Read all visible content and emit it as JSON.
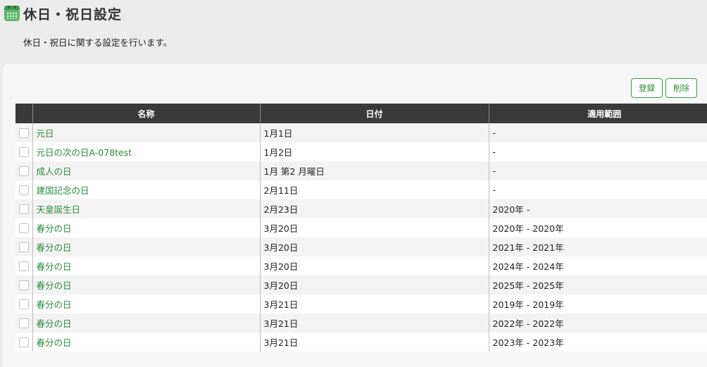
{
  "header": {
    "title": "休日・祝日設定",
    "description": "休日・祝日に関する設定を行います。"
  },
  "toolbar": {
    "register_label": "登録",
    "delete_label": "削除"
  },
  "table": {
    "columns": [
      "名称",
      "日付",
      "適用範囲"
    ],
    "rows": [
      {
        "name": "元日",
        "date": "1月1日",
        "range": "-"
      },
      {
        "name": "元日の次の日A-078test",
        "date": "1月2日",
        "range": "-"
      },
      {
        "name": "成人の日",
        "date": "1月 第2 月曜日",
        "range": "-"
      },
      {
        "name": "建国記念の日",
        "date": "2月11日",
        "range": "-"
      },
      {
        "name": "天皇誕生日",
        "date": "2月23日",
        "range": "2020年 -"
      },
      {
        "name": "春分の日",
        "date": "3月20日",
        "range": "2020年 - 2020年"
      },
      {
        "name": "春分の日",
        "date": "3月20日",
        "range": "2021年 - 2021年"
      },
      {
        "name": "春分の日",
        "date": "3月20日",
        "range": "2024年 - 2024年"
      },
      {
        "name": "春分の日",
        "date": "3月20日",
        "range": "2025年 - 2025年"
      },
      {
        "name": "春分の日",
        "date": "3月21日",
        "range": "2019年 - 2019年"
      },
      {
        "name": "春分の日",
        "date": "3月21日",
        "range": "2022年 - 2022年"
      },
      {
        "name": "春分の日",
        "date": "3月21日",
        "range": "2023年 - 2023年"
      }
    ]
  },
  "colors": {
    "accent": "#2a8a3b",
    "header_bg": "#3a3a3a"
  },
  "icons": {
    "page": "calendar-icon"
  }
}
